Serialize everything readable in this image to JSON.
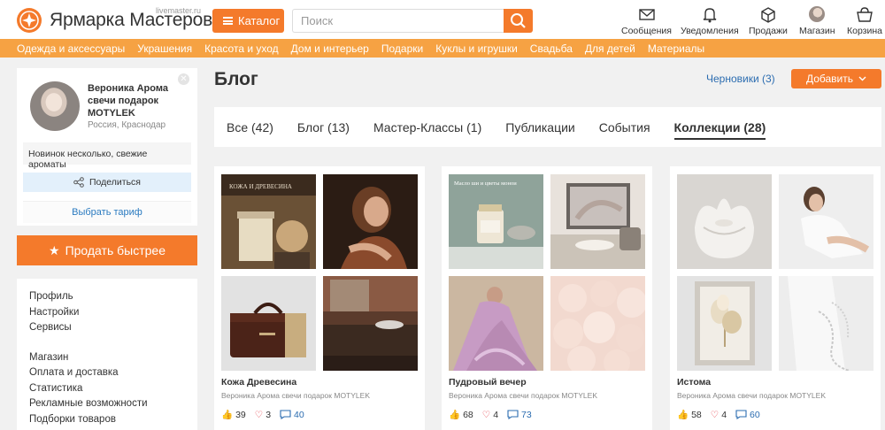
{
  "header": {
    "brand": "Ярмарка Мастеров",
    "brand_sub": "livemaster.ru",
    "catalog": "Каталог",
    "search_placeholder": "Поиск",
    "nav": [
      {
        "label": "Сообщения",
        "icon": "envelope-icon"
      },
      {
        "label": "Уведомления",
        "icon": "bell-icon"
      },
      {
        "label": "Продажи",
        "icon": "box-icon"
      },
      {
        "label": "Магазин",
        "icon": "avatar"
      },
      {
        "label": "Корзина",
        "icon": "basket-icon"
      }
    ]
  },
  "categories": [
    "Одежда и аксессуары",
    "Украшения",
    "Красота и уход",
    "Дом и интерьер",
    "Подарки",
    "Куклы и игрушки",
    "Свадьба",
    "Для детей",
    "Материалы"
  ],
  "profile": {
    "name": "Вероника Арома свечи подарок MOTYLEK",
    "location": "Россия, Краснодар",
    "note": "Новинок несколько, свежие ароматы",
    "share": "Поделиться",
    "tariff": "Выбрать тариф"
  },
  "sell_button": "Продать быстрее",
  "menu": {
    "group1": [
      "Профиль",
      "Настройки",
      "Сервисы"
    ],
    "group2": [
      "Магазин",
      "Оплата и доставка",
      "Статистика",
      "Рекламные возможности",
      "Подборки товаров"
    ]
  },
  "blog": {
    "title": "Блог",
    "drafts": "Черновики (3)",
    "add": "Добавить"
  },
  "tabs": [
    "Все (42)",
    "Блог (13)",
    "Мастер-Классы (1)",
    "Публикации",
    "События",
    "Коллекции (28)"
  ],
  "active_tab": "Коллекции (28)",
  "collections": [
    {
      "title": "Кожа Древесина",
      "author": "Вероника Арома свечи подарок MOTYLEK",
      "likes": "39",
      "hearts": "3",
      "comments": "40",
      "image_texts": [
        "КОЖА И ДРЕВЕСИНА",
        "",
        "",
        ""
      ]
    },
    {
      "title": "Пудровый вечер",
      "author": "Вероника Арома свечи подарок MOTYLEK",
      "likes": "68",
      "hearts": "4",
      "comments": "73",
      "image_texts": [
        "Масло ши и цветы монои",
        "",
        "",
        ""
      ]
    },
    {
      "title": "Истома",
      "author": "Вероника Арома свечи подарок MOTYLEK",
      "likes": "58",
      "hearts": "4",
      "comments": "60",
      "image_texts": [
        "",
        "",
        "",
        ""
      ]
    }
  ],
  "colors": {
    "accent": "#f47a2b",
    "category_bar": "#f6a243",
    "link": "#2b6cb0"
  }
}
